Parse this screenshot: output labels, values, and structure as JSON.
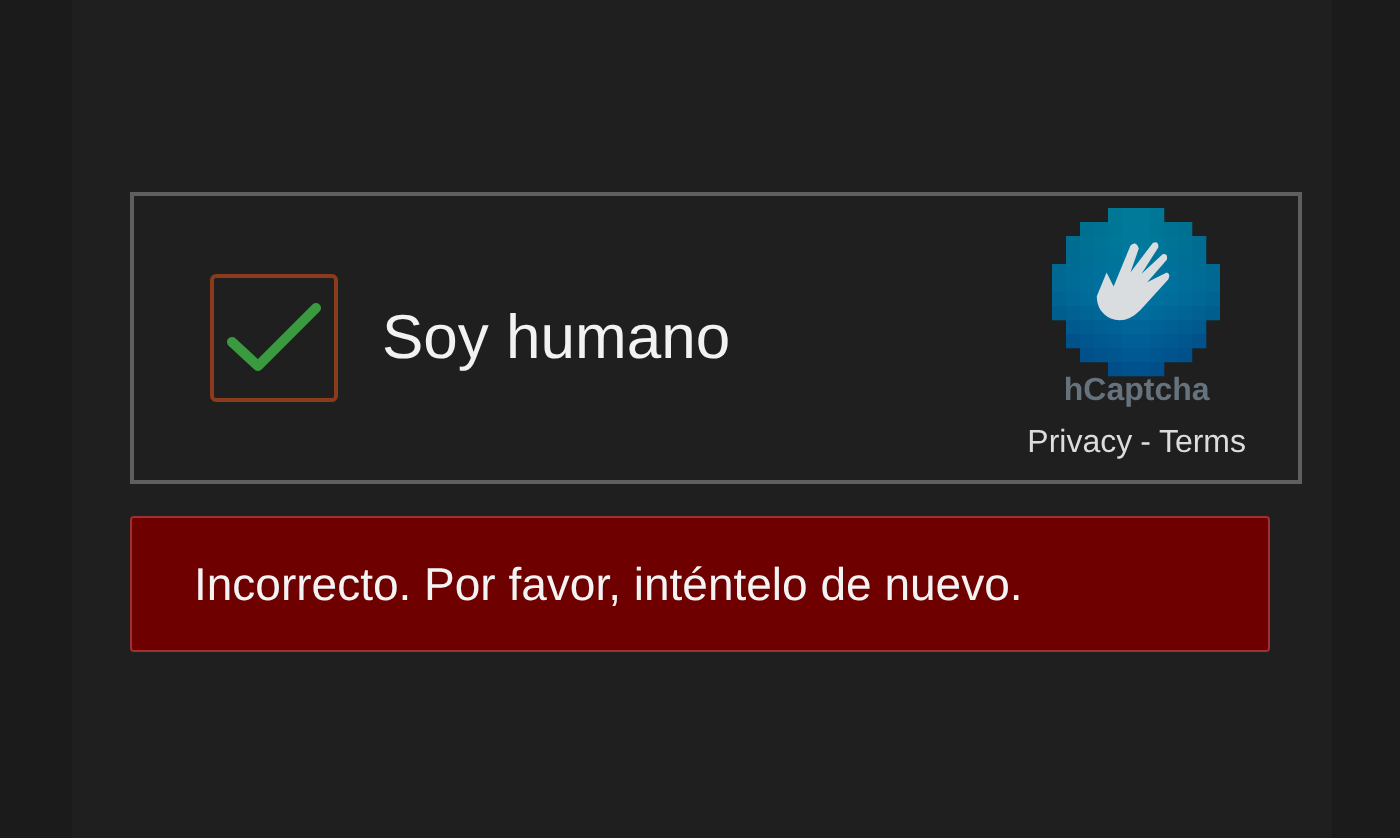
{
  "captcha": {
    "checkbox": {
      "label": "Soy humano",
      "checked": true
    },
    "brand": "hCaptcha",
    "privacy_link": "Privacy",
    "separator": "-",
    "terms_link": "Terms"
  },
  "error": {
    "message": "Incorrecto. Por favor, inténtelo de nuevo."
  }
}
